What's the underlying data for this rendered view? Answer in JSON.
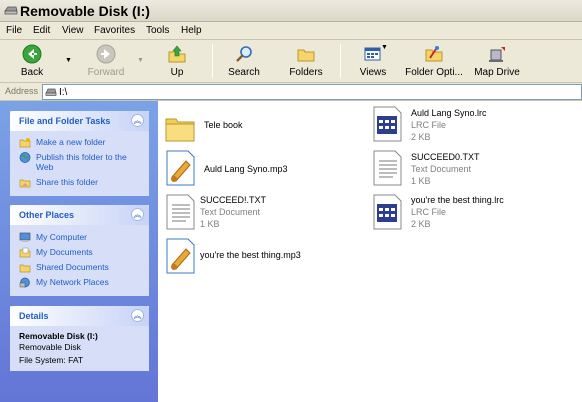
{
  "window": {
    "title": "Removable Disk (I:)"
  },
  "menu": [
    "File",
    "Edit",
    "View",
    "Favorites",
    "Tools",
    "Help"
  ],
  "toolbar": {
    "back": "Back",
    "forward": "Forward",
    "up": "Up",
    "search": "Search",
    "folders": "Folders",
    "views": "Views",
    "folder_options": "Folder Opti...",
    "map_drive": "Map Drive"
  },
  "address": {
    "label": "Address",
    "path": "I:\\"
  },
  "tasks": {
    "file_folder": {
      "title": "File and Folder Tasks",
      "items": [
        "Make a new folder",
        "Publish this folder to the Web",
        "Share this folder"
      ]
    },
    "other_places": {
      "title": "Other Places",
      "items": [
        "My Computer",
        "My Documents",
        "Shared Documents",
        "My Network Places"
      ]
    },
    "details": {
      "title": "Details",
      "name": "Removable Disk (I:)",
      "type": "Removable Disk",
      "fs": "File System: FAT"
    }
  },
  "files": [
    {
      "name": "Tele book",
      "type": "",
      "size": "",
      "icon": "folder-icon"
    },
    {
      "name": "Auld Lang Syno.lrc",
      "type": "LRC File",
      "size": "2 KB",
      "icon": "lrc-file-icon"
    },
    {
      "name": "Auld Lang Syno.mp3",
      "type": "",
      "size": "",
      "icon": "mp3-file-icon"
    },
    {
      "name": "SUCCEED0.TXT",
      "type": "Text Document",
      "size": "1 KB",
      "icon": "text-file-icon"
    },
    {
      "name": "SUCCEED!.TXT",
      "type": "Text Document",
      "size": "1 KB",
      "icon": "text-file-icon"
    },
    {
      "name": "you're the best thing.lrc",
      "type": "LRC File",
      "size": "2 KB",
      "icon": "lrc-file-icon"
    },
    {
      "name": "you're the best thing.mp3",
      "type": "",
      "size": "",
      "icon": "mp3-file-icon"
    }
  ],
  "colors": {
    "task_link": "#215dc6",
    "pane_top": "#7ba2e7",
    "pane_bottom": "#6375d6",
    "panel_bg": "#d6dff7"
  }
}
